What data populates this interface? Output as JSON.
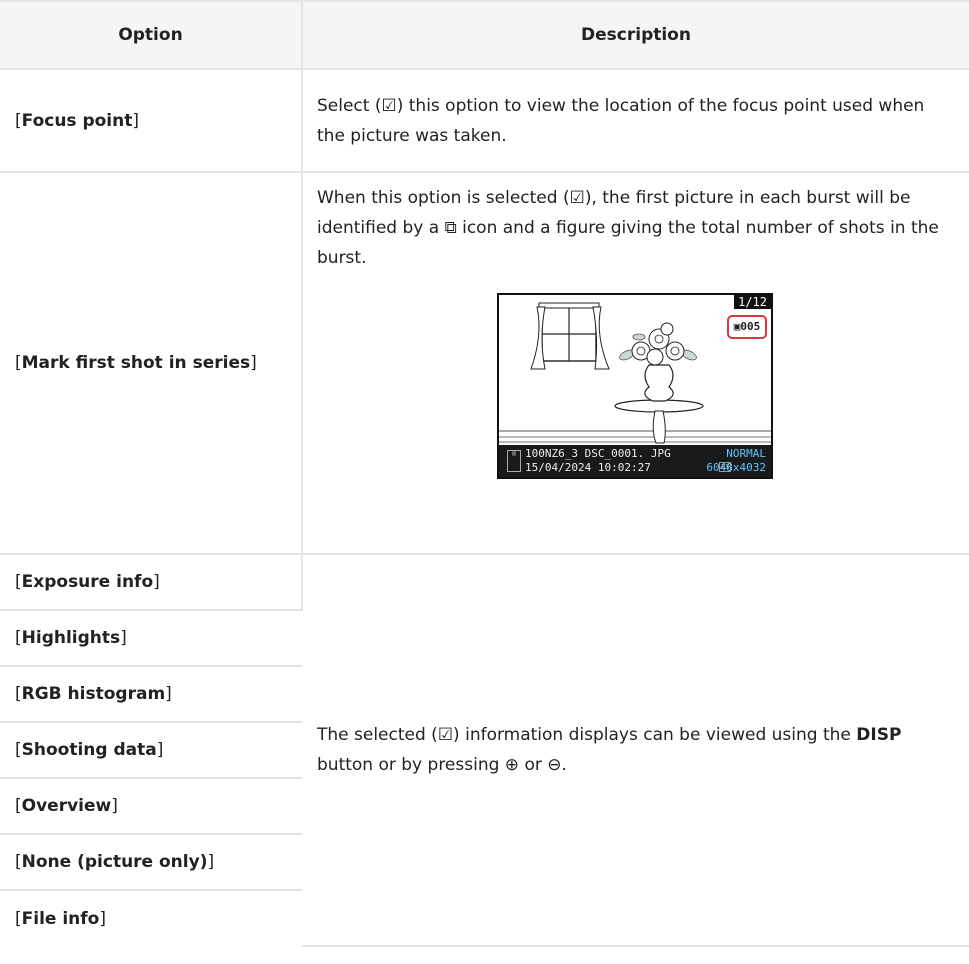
{
  "table": {
    "headers": {
      "option": "Option",
      "description": "Description"
    },
    "rows": [
      {
        "name": "Focus point",
        "description": "Select (☑) this option to view the location of the focus point used when the picture was taken."
      },
      {
        "name": "Mark first shot in series",
        "description": "When this option is selected (☑), the first picture in each burst will be identified by a ⧉ icon and a figure giving the total number of shots in the burst."
      },
      {
        "name": "Exposure info"
      },
      {
        "name": "Highlights"
      },
      {
        "name": "RGB histogram"
      },
      {
        "name": "Shooting data"
      },
      {
        "name": "Overview"
      },
      {
        "name": "None (picture only)"
      },
      {
        "name": "File info"
      }
    ],
    "shared_description": {
      "before": "The selected (☑) information displays can be viewed using the ",
      "button": "DISP",
      "after": " button or by pressing ⊕ or ⊖."
    }
  },
  "screen": {
    "counter": "1/12",
    "burst_count": "▣005",
    "folder_file": "100NZ6_3  DSC_0001. JPG",
    "datetime": "15/04/2024  10:02:27",
    "quality": "NORMAL",
    "size": "6048x4032",
    "area": "FX"
  }
}
